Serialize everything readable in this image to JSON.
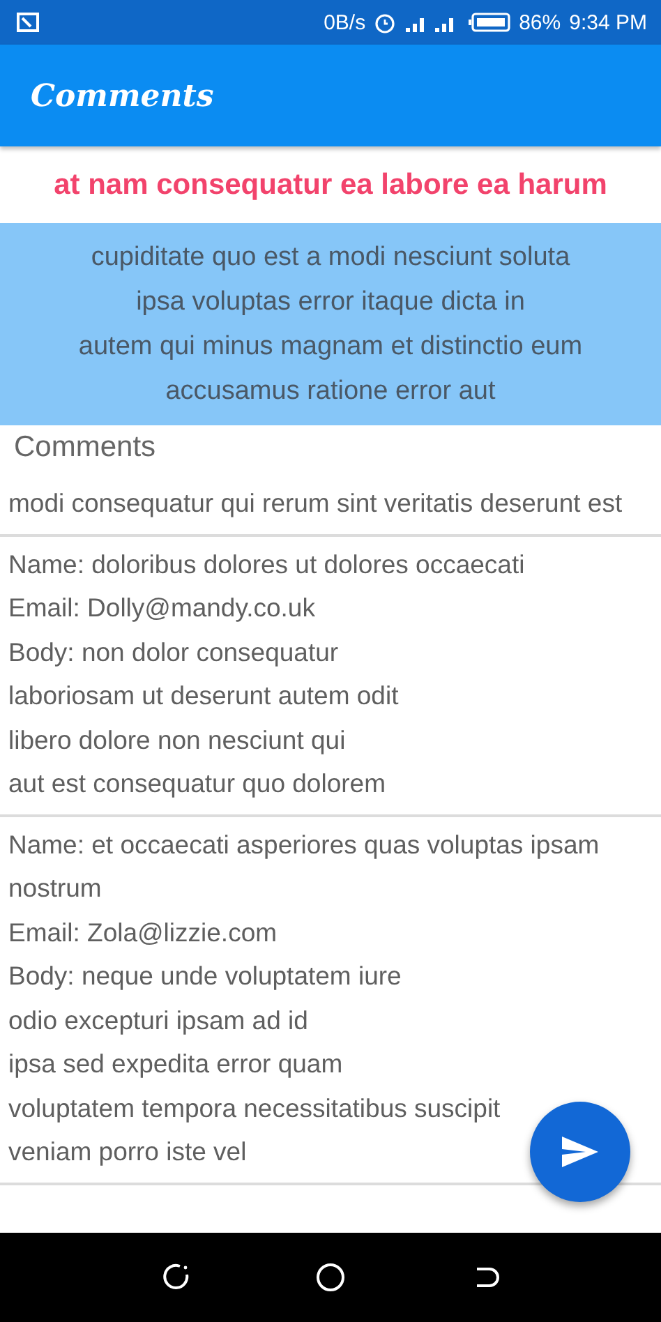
{
  "status_bar": {
    "speed": "0B/s",
    "battery": "86%",
    "time": "9:34 PM"
  },
  "app_bar": {
    "title": "Comments"
  },
  "post": {
    "title": "at nam consequatur ea labore ea harum",
    "body_lines": [
      "cupiditate quo est a modi nesciunt soluta",
      "ipsa voluptas error itaque dicta in",
      "autem qui minus magnam et distinctio eum",
      "accusamus ratione error aut"
    ]
  },
  "comments_header": "Comments",
  "comments": [
    {
      "lines": [
        "modi consequatur qui rerum sint veritatis deserunt est"
      ]
    },
    {
      "lines": [
        "Name: doloribus dolores ut dolores occaecati",
        "Email: Dolly@mandy.co.uk",
        "Body: non dolor consequatur",
        "laboriosam ut deserunt autem odit",
        "libero dolore non nesciunt qui",
        "aut est consequatur quo dolorem"
      ]
    },
    {
      "lines": [
        "Name: et occaecati asperiores quas voluptas ipsam nostrum",
        "Email: Zola@lizzie.com",
        "Body: neque unde voluptatem iure",
        "odio excepturi ipsam ad id",
        "ipsa sed expedita error quam",
        "voluptatem tempora necessitatibus suscipit",
        "veniam porro iste vel"
      ]
    }
  ]
}
